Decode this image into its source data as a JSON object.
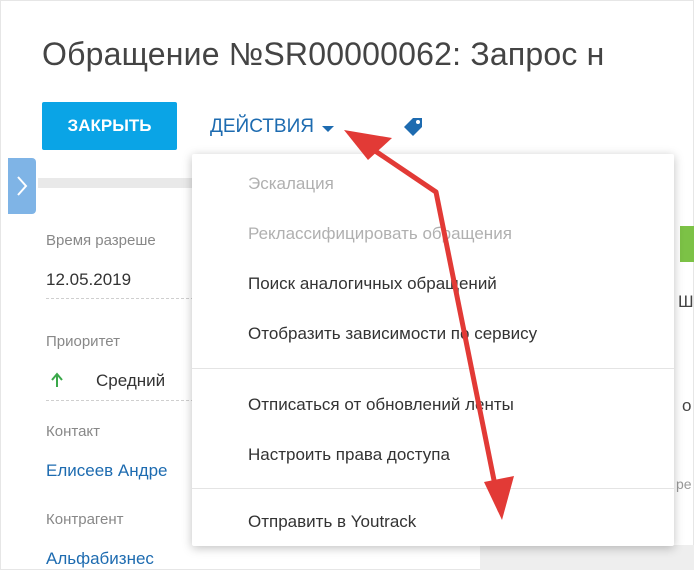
{
  "page": {
    "title": "Обращение №SR00000062: Запрос н"
  },
  "toolbar": {
    "close_label": "ЗАКРЫТЬ",
    "actions_label": "ДЕЙСТВИЯ"
  },
  "fields": {
    "resolution_time_label": "Время разреше",
    "resolution_time_value": "12.05.2019",
    "priority_label": "Приоритет",
    "priority_value": "Средний",
    "contact_label": "Контакт",
    "contact_value": "Елисеев Андре",
    "account_label": "Контрагент",
    "account_value": "Альфабизнес"
  },
  "actions_menu": {
    "items": [
      {
        "label": "Эскалация",
        "disabled": true
      },
      {
        "label": "Реклассифицировать обращения",
        "disabled": true
      },
      {
        "label": "Поиск аналогичных обращений",
        "disabled": false
      },
      {
        "label": "Отобразить зависимости по сервису",
        "disabled": false
      },
      {
        "label": "Отписаться от обновлений ленты",
        "disabled": false
      },
      {
        "label": "Настроить права доступа",
        "disabled": false
      },
      {
        "label": "Отправить в Youtrack",
        "disabled": false
      }
    ]
  },
  "right_panel": {
    "partial_text_1": "Ш",
    "partial_text_2": "о",
    "partial_text_3": "ре"
  },
  "colors": {
    "primary_button": "#0aa4e6",
    "link": "#1d6bb0",
    "annotation_arrow": "#e23a36",
    "priority_arrow": "#3aa84a",
    "green_indicator": "#7cc246"
  },
  "icons": {
    "tag": "tag-icon",
    "caret": "chevron-down-icon",
    "side_toggle": "chevron-right-icon",
    "priority": "arrow-up-icon"
  }
}
